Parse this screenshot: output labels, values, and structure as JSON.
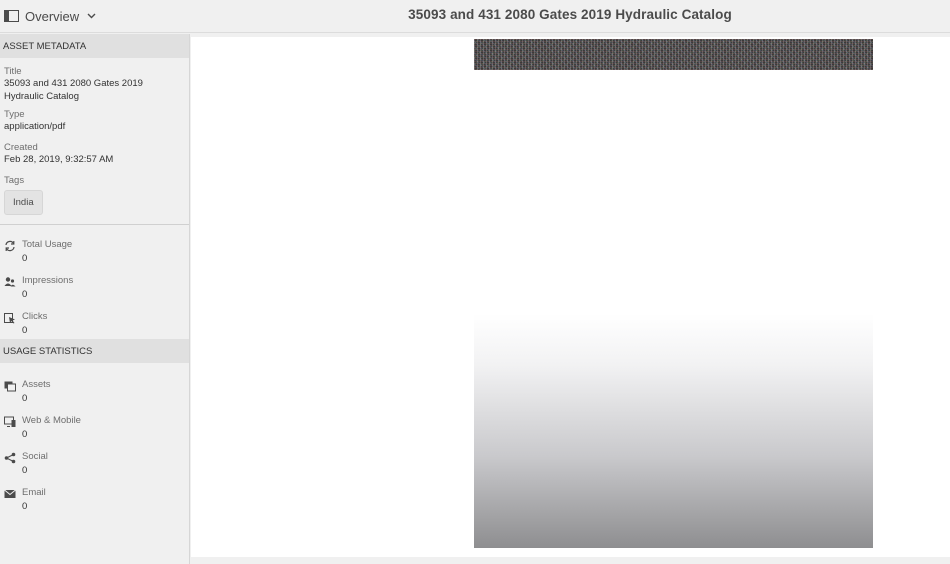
{
  "header": {
    "rail_label": "Overview",
    "title": "35093 and 431 2080 Gates 2019 Hydraulic Catalog"
  },
  "asset_metadata": {
    "heading": "ASSET METADATA",
    "title_label": "Title",
    "title_value": "35093 and 431 2080 Gates 2019 Hydraulic Catalog",
    "type_label": "Type",
    "type_value": "application/pdf",
    "created_label": "Created",
    "created_value": "Feb 28, 2019, 9:32:57 AM",
    "tags_label": "Tags",
    "tags": [
      "India"
    ]
  },
  "insights": [
    {
      "label": "Total Usage",
      "value": "0",
      "icon": "sync-icon"
    },
    {
      "label": "Impressions",
      "value": "0",
      "icon": "impressions-icon"
    },
    {
      "label": "Clicks",
      "value": "0",
      "icon": "click-icon"
    }
  ],
  "usage_statistics": {
    "heading": "USAGE STATISTICS",
    "items": [
      {
        "label": "Assets",
        "value": "0",
        "icon": "assets-icon"
      },
      {
        "label": "Web & Mobile",
        "value": "0",
        "icon": "web-mobile-icon"
      },
      {
        "label": "Social",
        "value": "0",
        "icon": "share-icon"
      },
      {
        "label": "Email",
        "value": "0",
        "icon": "email-icon"
      }
    ]
  },
  "colors": {
    "rail_bg": "#f0f0f0",
    "section_bg": "#e0e0e0",
    "content_bg": "#ffffff"
  }
}
